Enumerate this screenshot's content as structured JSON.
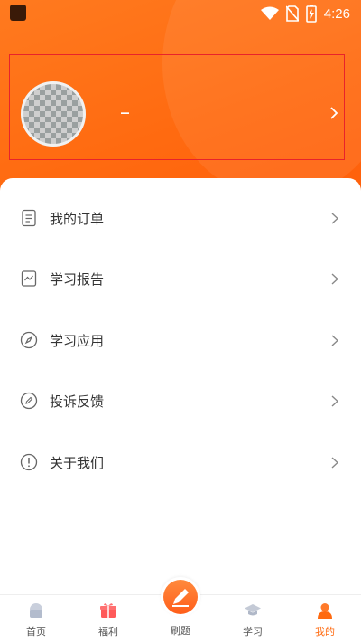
{
  "status_bar": {
    "time": "4:26",
    "icons": [
      "wifi-icon",
      "no-sim-icon",
      "battery-icon"
    ]
  },
  "profile": {
    "nickname": "_",
    "account_id": ""
  },
  "menu": [
    {
      "label": "我的订单",
      "icon": "order-icon"
    },
    {
      "label": "学习报告",
      "icon": "report-icon"
    },
    {
      "label": "学习应用",
      "icon": "compass-icon"
    },
    {
      "label": "投诉反馈",
      "icon": "feedback-icon"
    },
    {
      "label": "关于我们",
      "icon": "info-icon"
    }
  ],
  "tabs": [
    {
      "label": "首页",
      "icon": "home-icon"
    },
    {
      "label": "福利",
      "icon": "gift-icon"
    },
    {
      "label": "刷题",
      "icon": "pen-icon"
    },
    {
      "label": "学习",
      "icon": "graduation-cap-icon"
    },
    {
      "label": "我的",
      "icon": "profile-icon",
      "active": true
    }
  ],
  "colors": {
    "accent": "#ff6a10",
    "frame": "#e8232b"
  }
}
